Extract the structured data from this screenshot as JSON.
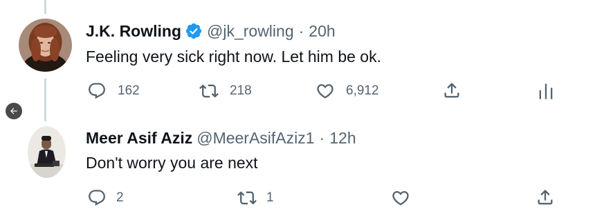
{
  "tweets": [
    {
      "display_name": "J.K. Rowling",
      "verified": true,
      "handle": "@jk_rowling",
      "separator": "·",
      "time": "20h",
      "text": "Feeling very sick right now. Let him be ok.",
      "replies": "162",
      "retweets": "218",
      "likes": "6,912"
    },
    {
      "display_name": "Meer Asif Aziz",
      "verified": false,
      "handle": "@MeerAsifAziz1",
      "separator": "·",
      "time": "12h",
      "text": "Don't worry you are next",
      "replies": "2",
      "retweets": "1",
      "likes": ""
    }
  ],
  "icons": {
    "reply": "reply-icon",
    "retweet": "retweet-icon",
    "like": "heart-icon",
    "share": "share-icon",
    "analytics": "analytics-icon",
    "verified": "verified-badge-icon",
    "back": "back-arrow-icon"
  },
  "colors": {
    "text": "#0f1419",
    "secondary": "#536471",
    "verified": "#1d9bf0",
    "thread_line": "#cfd9de"
  }
}
